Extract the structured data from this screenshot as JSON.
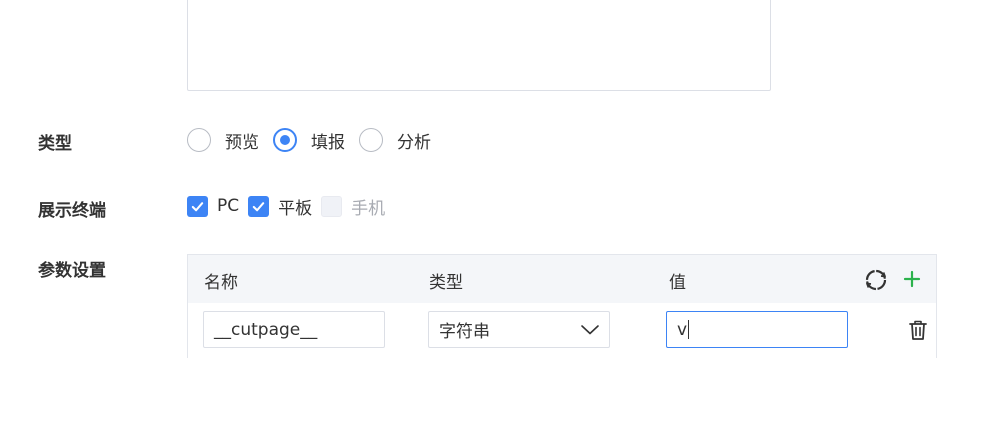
{
  "form": {
    "type_label": "类型",
    "terminal_label": "展示终端",
    "params_label": "参数设置"
  },
  "type_options": [
    {
      "label": "预览",
      "checked": false
    },
    {
      "label": "填报",
      "checked": true
    },
    {
      "label": "分析",
      "checked": false
    }
  ],
  "terminal_options": [
    {
      "label": "PC",
      "checked": true,
      "disabled": false
    },
    {
      "label": "平板",
      "checked": true,
      "disabled": false
    },
    {
      "label": "手机",
      "checked": false,
      "disabled": true
    }
  ],
  "param_table": {
    "headers": {
      "name": "名称",
      "type": "类型",
      "value": "值"
    },
    "rows": [
      {
        "name": "__cutpage__",
        "type": "字符串",
        "value": "v"
      }
    ]
  },
  "colors": {
    "accent": "#3d84f5",
    "add": "#2bb24c",
    "border": "#dcdfe6",
    "header_bg": "#f4f6f9"
  },
  "icons": {
    "refresh": "refresh-icon",
    "add": "plus-icon",
    "delete": "trash-icon",
    "dropdown": "chevron-down-icon"
  }
}
